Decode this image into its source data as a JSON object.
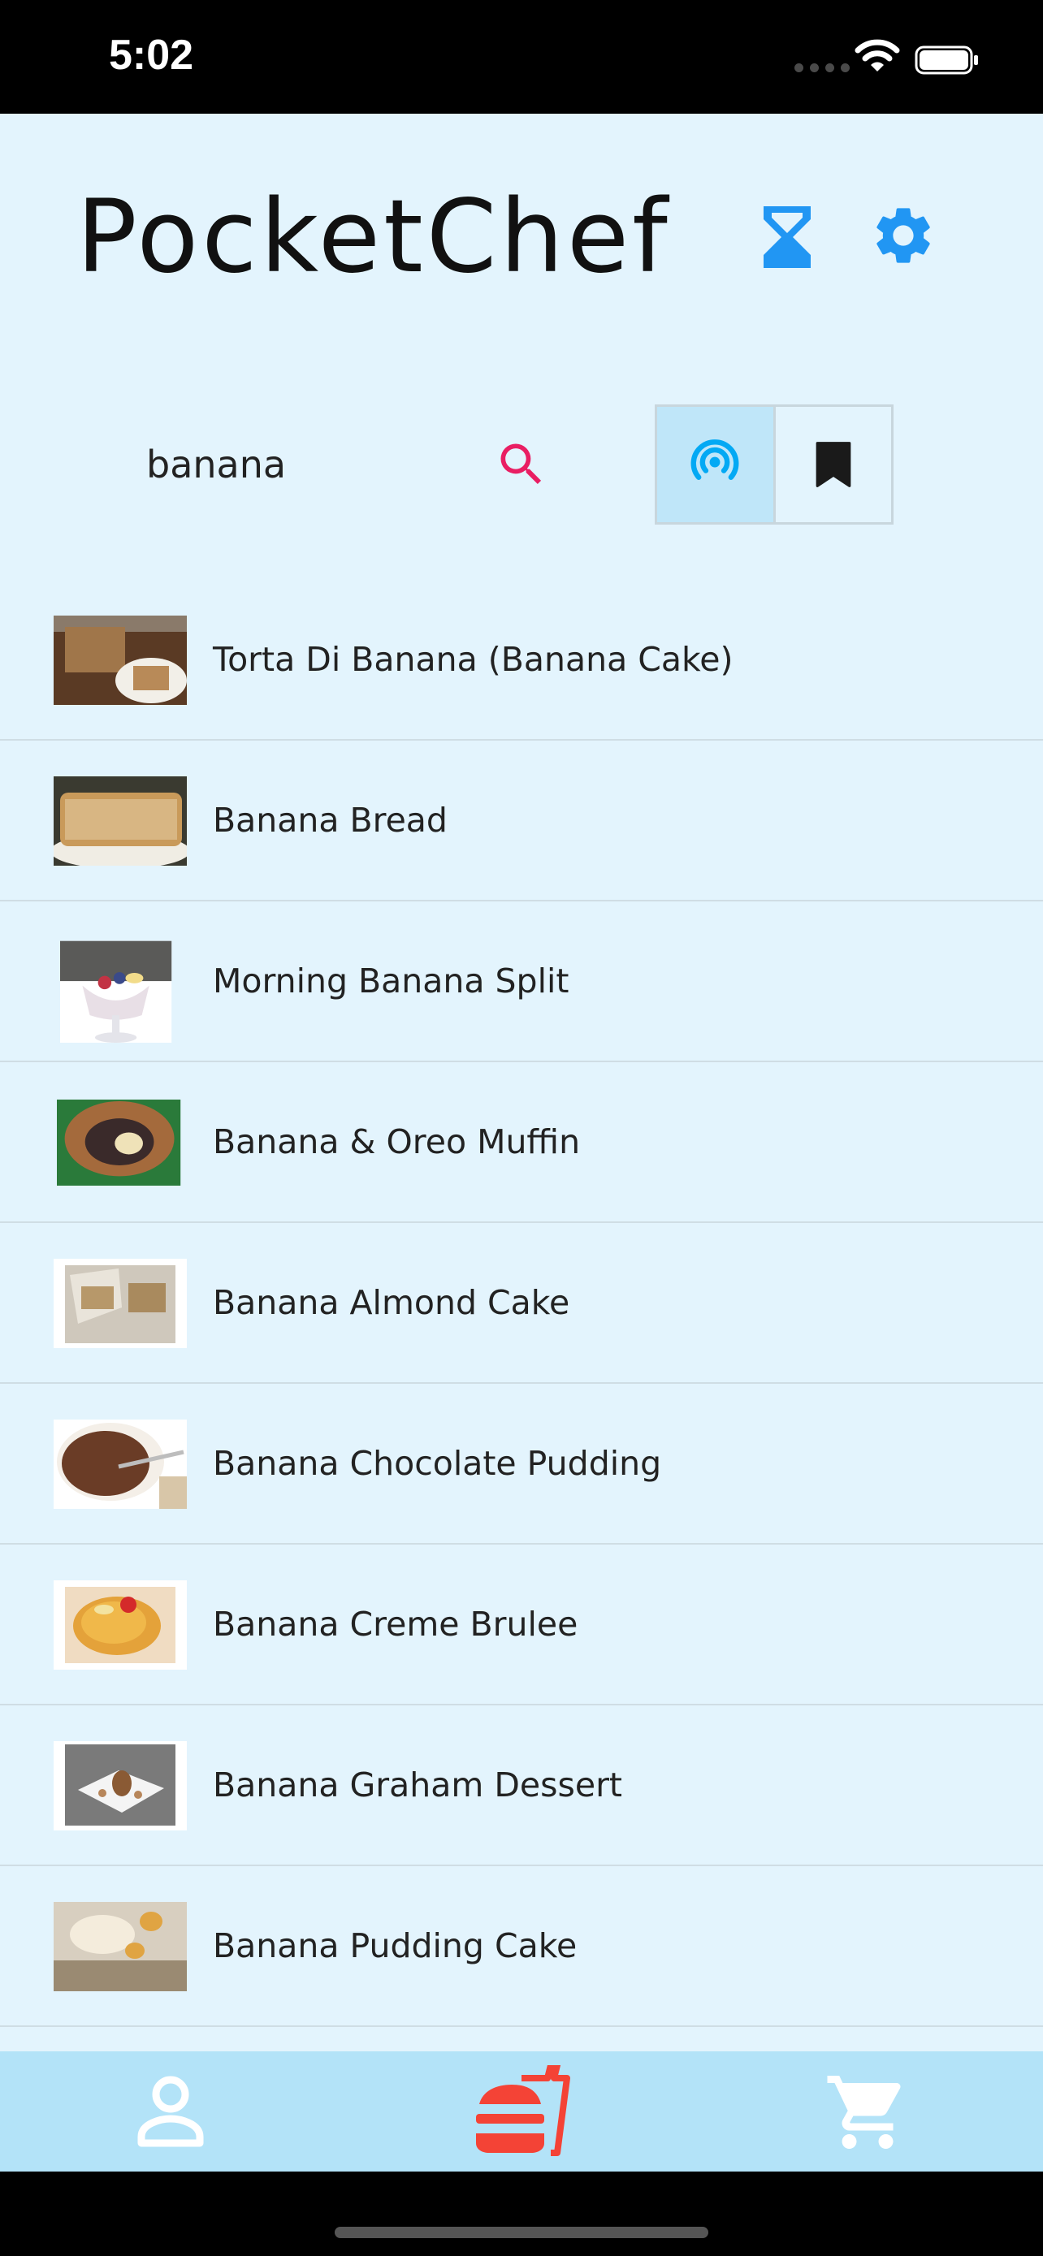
{
  "status_bar": {
    "time": "5:02"
  },
  "header": {
    "title": "PocketChef"
  },
  "search": {
    "value": "banana"
  },
  "recipes": [
    {
      "name": "Torta Di Banana (Banana Cake)"
    },
    {
      "name": "Banana Bread"
    },
    {
      "name": "Morning Banana Split"
    },
    {
      "name": "Banana & Oreo Muffin"
    },
    {
      "name": "Banana Almond Cake"
    },
    {
      "name": "Banana Chocolate Pudding"
    },
    {
      "name": "Banana Creme Brulee"
    },
    {
      "name": "Banana Graham Dessert"
    },
    {
      "name": "Banana Pudding Cake"
    }
  ],
  "icons": {
    "timer": "hourglass-icon",
    "settings": "gear-icon",
    "search": "search-icon",
    "online": "broadcast-icon",
    "bookmarks": "bookmark-icon",
    "profile": "person-icon",
    "recipes": "fastfood-icon",
    "cart": "cart-icon"
  },
  "colors": {
    "accent_blue": "#2196f3",
    "search_pink": "#e91e63",
    "nav_active": "#f44336",
    "background": "#e3f4fd",
    "nav_background": "#b3e3f8"
  },
  "toggle": {
    "selected": "online"
  },
  "bottom_nav": {
    "active": "recipes"
  }
}
